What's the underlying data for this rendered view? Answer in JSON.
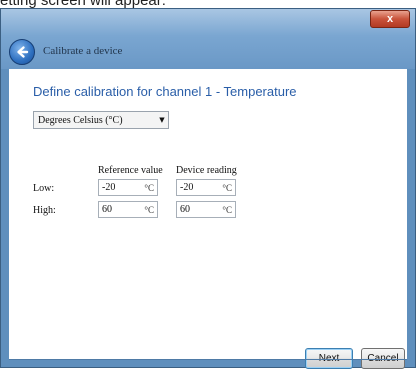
{
  "top_caption": "etting screen will appear:",
  "window": {
    "title": "Calibrate a device",
    "close_label": "x"
  },
  "content": {
    "heading": "Define calibration for channel 1 - Temperature",
    "unit_select": {
      "value": "Degrees Celsius (°C)"
    },
    "columns": {
      "reference": "Reference value",
      "device": "Device reading"
    },
    "rows": [
      {
        "label": "Low:",
        "reference": {
          "value": "-20",
          "unit": "°C"
        },
        "device": {
          "value": "-20",
          "unit": "°C"
        }
      },
      {
        "label": "High:",
        "reference": {
          "value": "60",
          "unit": "°C"
        },
        "device": {
          "value": "60",
          "unit": "°C"
        }
      }
    ]
  },
  "buttons": {
    "next": "Next",
    "cancel": "Cancel"
  },
  "icons": {
    "back": "back-arrow-icon",
    "dropdown": "chevron-down-icon",
    "close": "close-icon"
  },
  "colors": {
    "heading": "#2a5ea8",
    "frame": "#6a98c6",
    "close": "#c9533b"
  }
}
